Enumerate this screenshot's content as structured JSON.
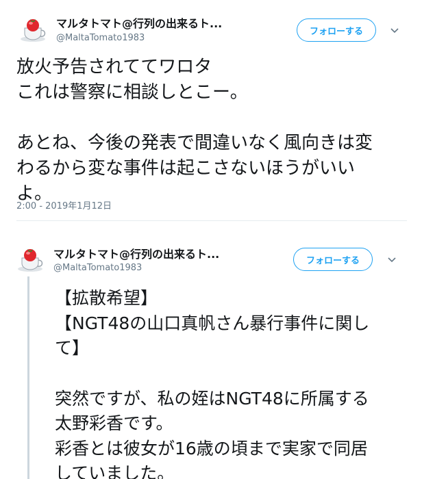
{
  "colors": {
    "accent": "#1da1f2",
    "muted": "#657786",
    "thread": "#ccd6dd",
    "tomato": "#e0282e"
  },
  "tweet1": {
    "name": "マルタトマト@行列の出来るト...",
    "handle": "@MaltaTomato1983",
    "follow_label": "フォローする",
    "lines": [
      "放火予告されててワロタ",
      "これは警察に相談しとこー。",
      "",
      "あとね、今後の発表で間違いなく風向きは変",
      "わるから変な事件は起こさないほうがいい",
      "よ。"
    ],
    "timestamp": "2:00 - 2019年1月12日"
  },
  "tweet2": {
    "name": "マルタトマト@行列の出来るト...",
    "handle": "@MaltaTomato1983",
    "follow_label": "フォローする",
    "lines": [
      "【拡散希望】",
      "【NGT48の山口真帆さん暴行事件に関し",
      "て】",
      "",
      "突然ですが、私の姪はNGT48に所属する",
      "太野彩香です。",
      "彩香とは彼女が16歳の頃まで実家で同居",
      "していました。"
    ]
  }
}
